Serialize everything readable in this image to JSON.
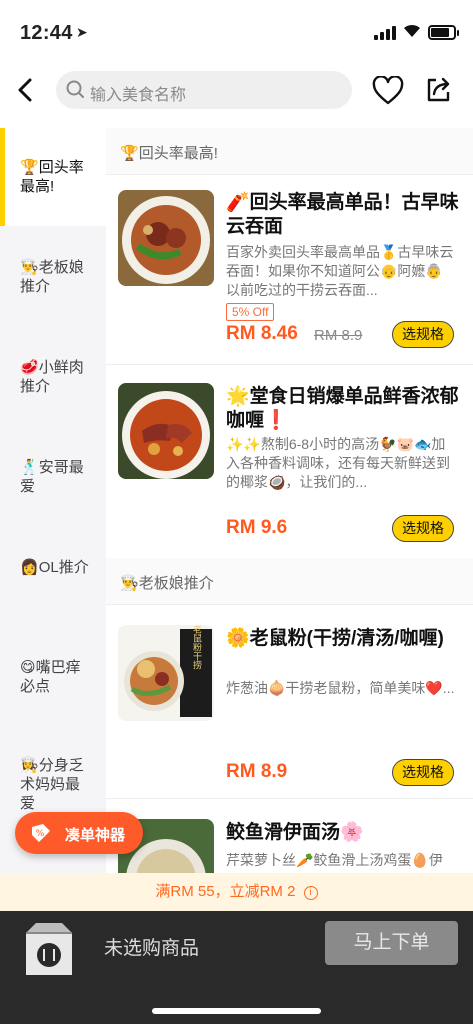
{
  "status": {
    "time": "12:44",
    "location_icon": "location-arrow-icon"
  },
  "header": {
    "search_placeholder": "输入美食名称"
  },
  "sidebar": {
    "items": [
      {
        "emoji": "🏆",
        "label": "回头率最高!"
      },
      {
        "emoji": "👨‍🍳",
        "label": "老板娘推介"
      },
      {
        "emoji": "🥩",
        "label": "小鲜肉推介"
      },
      {
        "emoji": "🕺",
        "label": "安哥最爱"
      },
      {
        "emoji": "👩",
        "label": "OL推介"
      },
      {
        "emoji": "😋",
        "label": "嘴巴痒必点"
      },
      {
        "emoji": "👩‍🍳",
        "label": "分身乏术妈妈最爱"
      }
    ]
  },
  "sections": [
    {
      "emoji": "🏆",
      "title": "回头率最高!"
    },
    {
      "emoji": "👨‍🍳",
      "title": "老板娘推介"
    }
  ],
  "dishes": [
    {
      "name": "🧨回头率最高单品！古早味云吞面",
      "desc": "百家外卖回头率最高单品🥇古早味云吞面！如果你不知道阿公👴阿嬷👵以前吃过的干捞云吞面...",
      "badge": "5% Off",
      "price": "RM 8.46",
      "old_price": "RM 8.9",
      "spec_label": "选规格"
    },
    {
      "name": "🌟堂食日销爆单品鲜香浓郁咖喱❗",
      "desc": "✨✨熬制6-8小时的高汤🐓🐷🐟加入各种香料调味，还有每天新鲜送到的椰浆🥥，让我们的...",
      "price": "RM 9.6",
      "spec_label": "选规格"
    },
    {
      "name": "🌼老鼠粉(干捞/清汤/咖喱)",
      "desc": "炸葱油🧅干捞老鼠粉，简单美味❤️...",
      "price": "RM 8.9",
      "spec_label": "选规格",
      "image_text": "老鼠粉干捞"
    },
    {
      "name": "鲛鱼滑伊面汤🌸",
      "desc": "芹菜萝卜丝🥕鲛鱼滑上汤鸡蛋🥚伊面"
    }
  ],
  "helper": {
    "label": "凑单神器"
  },
  "promo": {
    "text": "满RM 55，立减RM 2",
    "info": "i"
  },
  "bottom": {
    "empty_text": "未选购商品",
    "order_label": "马上下单"
  },
  "colors": {
    "accent": "#ffd000",
    "price": "#ff5a1f",
    "promo_bg": "#fff5e0"
  }
}
